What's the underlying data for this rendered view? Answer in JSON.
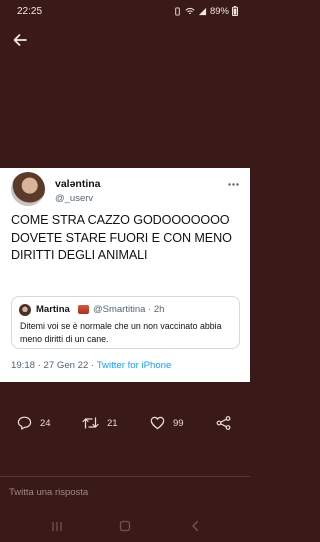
{
  "status_bar": {
    "time": "22:25",
    "battery": "89%"
  },
  "tweet": {
    "author_name": "valəntina",
    "author_handle": "@_userv",
    "text": "COME STRA CAZZO GODOOOOOOO DOVETE STARE FUORI E CON MENO DIRITTI DEGLI ANIMALI",
    "timestamp": "19:18 · 27 Gen 22 · ",
    "source": "Twitter for iPhone",
    "quoted": {
      "name": "Martina",
      "handle": "@Smartitina · 2h",
      "text": "Ditemi voi se è normale che un non vaccinato abbia meno diritti di un cane."
    }
  },
  "actions": {
    "replies": "24",
    "retweets": "21",
    "likes": "99"
  },
  "reply_box": {
    "placeholder": "Twitta una risposta"
  },
  "colors": {
    "background": "#3a1a18",
    "card": "#ffffff",
    "link": "#1d9bf0"
  }
}
